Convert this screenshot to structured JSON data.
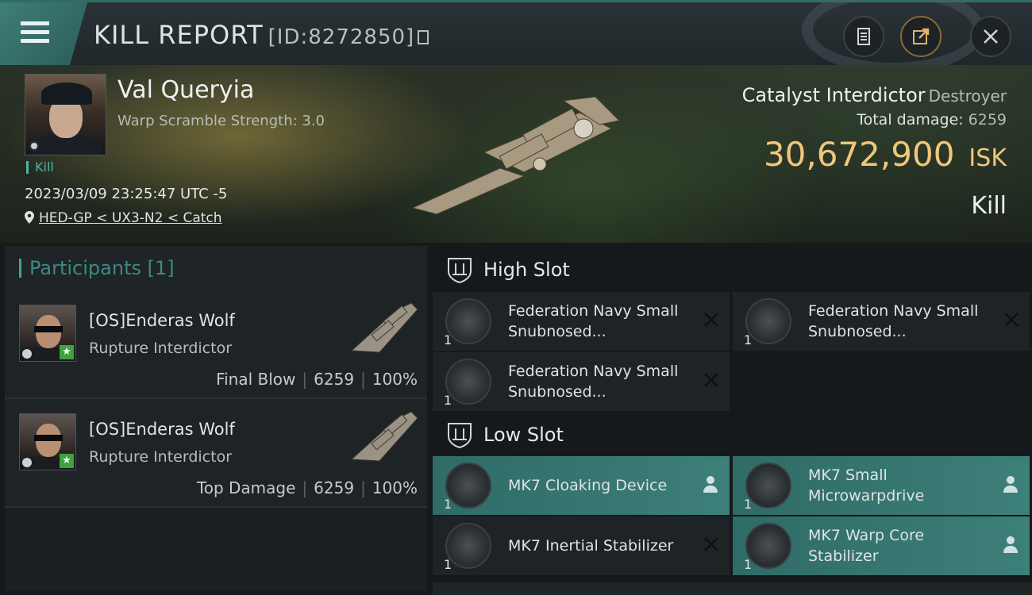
{
  "header": {
    "title": "KILL REPORT",
    "report_id": "[ID:8272850]",
    "icons": [
      "menu-icon",
      "copy-icon",
      "clipboard-icon",
      "share-icon",
      "close-icon"
    ]
  },
  "victim": {
    "name": "Val Queryia",
    "subtitle": "Warp Scramble Strength: 3.0",
    "tag": "Kill",
    "datetime": "2023/03/09 23:25:47 UTC -5",
    "location": "HED-GP < UX3-N2 < Catch",
    "ship": "Catalyst Interdictor",
    "ship_class": "Destroyer",
    "total_damage_label": "Total damage:",
    "total_damage": "6259",
    "isk_value": "30,672,900",
    "isk_unit": "ISK",
    "result": "Kill"
  },
  "participants": {
    "header": "Participants [1]",
    "rows": [
      {
        "name": "[OS]Enderas Wolf",
        "ship": "Rupture Interdictor",
        "role": "Final Blow",
        "damage": "6259",
        "percent": "100%"
      },
      {
        "name": "[OS]Enderas Wolf",
        "ship": "Rupture Interdictor",
        "role": "Top Damage",
        "damage": "6259",
        "percent": "100%"
      }
    ]
  },
  "slots": {
    "high": {
      "label": "High Slot",
      "modules": [
        {
          "name": "Federation Navy Small Snubnosed...",
          "count": "1",
          "state": "destroyed"
        },
        {
          "name": "Federation Navy Small Snubnosed...",
          "count": "1",
          "state": "destroyed"
        },
        {
          "name": "Federation Navy Small Snubnosed...",
          "count": "1",
          "state": "destroyed"
        }
      ]
    },
    "low": {
      "label": "Low Slot",
      "modules": [
        {
          "name": "MK7 Cloaking Device",
          "count": "1",
          "state": "dropped"
        },
        {
          "name": "MK7 Small Microwarpdrive",
          "count": "1",
          "state": "dropped"
        },
        {
          "name": "MK7 Inertial Stabilizer",
          "count": "1",
          "state": "destroyed"
        },
        {
          "name": "MK7 Warp Core Stabilizer",
          "count": "1",
          "state": "dropped"
        }
      ]
    }
  },
  "colors": {
    "accent": "#3d7f79",
    "isk": "#f0c77a",
    "tag": "#4fb3a7"
  }
}
